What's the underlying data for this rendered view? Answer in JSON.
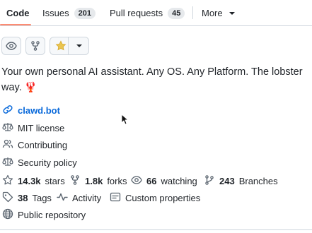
{
  "tabs": {
    "code": "Code",
    "issues": "Issues",
    "issues_count": "201",
    "pull_requests": "Pull requests",
    "pull_requests_count": "45",
    "more": "More"
  },
  "actions": {
    "watch_icon": "eye-icon",
    "fork_icon": "repo-forked-icon",
    "star_icon": "star-fill-icon",
    "star_color": "#eac54f",
    "dropdown_icon": "triangle-down-icon"
  },
  "description": {
    "text": "Your own personal AI assistant. Any OS. Any Platform. The lobster way.",
    "emoji": "🦞"
  },
  "about": {
    "website": "clawd.bot",
    "license": "MIT license",
    "contributing": "Contributing",
    "security": "Security policy"
  },
  "stats": {
    "stars_count": "14.3k",
    "stars_label": "stars",
    "forks_count": "1.8k",
    "forks_label": "forks",
    "watching_count": "66",
    "watching_label": "watching",
    "branches_count": "243",
    "branches_label": "Branches",
    "tags_count": "38",
    "tags_label": "Tags",
    "activity": "Activity",
    "custom_properties": "Custom properties",
    "visibility": "Public repository"
  },
  "colors": {
    "accent_underline": "#fd8c73",
    "link": "#0969da",
    "text": "#1f2328",
    "muted_icon": "#59636e"
  }
}
